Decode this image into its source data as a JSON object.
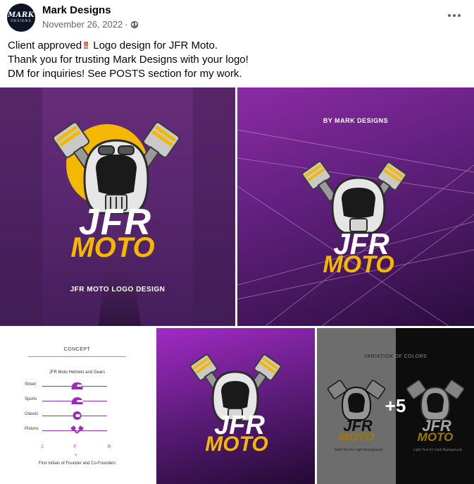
{
  "post": {
    "page_name": "Mark Designs",
    "avatar_text_1": "MARK",
    "avatar_text_2": "DESIGNS",
    "date": "November 26, 2022",
    "separator": "·",
    "audience_icon": "globe-icon",
    "more_icon": "more-options-icon"
  },
  "caption": {
    "line1_before": "Client approved",
    "line1_emoji": "!!",
    "line1_after": "Logo design for JFR Moto.",
    "line2": "Thank you for trusting Mark Designs with your logo!",
    "line3": "DM for inquiries! See POSTS section for my work."
  },
  "photos": {
    "photo1": {
      "logo_top": "JFR",
      "logo_bottom": "MOTO",
      "caption": "JFR MOTO LOGO DESIGN"
    },
    "photo2": {
      "caption": "BY MARK DESIGNS",
      "logo_top": "JFR",
      "logo_bottom": "MOTO"
    },
    "photo3": {
      "title": "CONCEPT",
      "subtitle": "JFR Moto Helmets and Gears",
      "rows": [
        {
          "label": "Street"
        },
        {
          "label": "Sports"
        },
        {
          "label": "Classic"
        },
        {
          "label": "Pistons"
        }
      ],
      "initials": [
        "J",
        "F",
        "R"
      ],
      "plus": "+",
      "footer": "First Initials of Founder and Co-Founders"
    },
    "photo4": {
      "logo_top": "JFR",
      "logo_bottom": "MOTO"
    },
    "photo5": {
      "title_left": "VARIATION ",
      "title_right": "OF COLORS",
      "note_left": "Dark Text for Light Background",
      "note_right": "Light Text for Dark Background",
      "logo_top": "JFR",
      "logo_bottom": "MOTO",
      "more_count": "+5"
    }
  },
  "colors": {
    "accent_yellow": "#f5b800",
    "purple": "#9b2cb5",
    "text_secondary": "#65676b"
  }
}
